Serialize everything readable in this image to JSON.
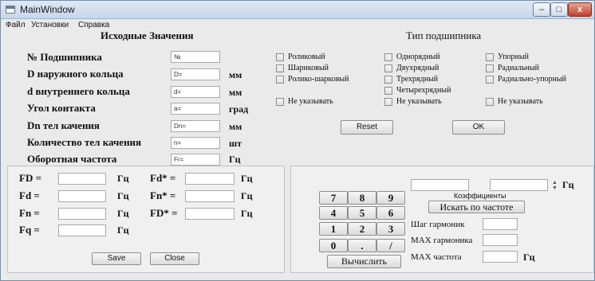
{
  "window": {
    "title": "MainWindow"
  },
  "titlebar_buttons": {
    "minimize": "–",
    "maximize": "□",
    "close": "x"
  },
  "menu": [
    "Файл",
    "Установки",
    "Справка"
  ],
  "initial_values": {
    "heading": "Исходные Значения",
    "rows": [
      {
        "label": "№ Подшипника",
        "placeholder": "№",
        "unit": ""
      },
      {
        "label": "D наружного кольца",
        "placeholder": "D=",
        "unit": "мм"
      },
      {
        "label": "d внутреннего кольца",
        "placeholder": "d=",
        "unit": "мм"
      },
      {
        "label": "Угол контакта",
        "placeholder": "a=",
        "unit": "град"
      },
      {
        "label": "Dn тел качения",
        "placeholder": "Dn=",
        "unit": "мм"
      },
      {
        "label": "Количество тел качения",
        "placeholder": "n=",
        "unit": "шт"
      },
      {
        "label": "Оборотная частота",
        "placeholder": "Fr=",
        "unit": "Гц"
      }
    ]
  },
  "bearing_type": {
    "heading": "Тип подшипника",
    "col1": [
      "Роликовый",
      "Шариковый",
      "Ролико-шарковый",
      "Не указывать"
    ],
    "col2": [
      "Однорядный",
      "Двухрядный",
      "Трехрядный",
      "Четырехрядный",
      "Не указывать"
    ],
    "col3": [
      "Упорный",
      "Радиальный",
      "Радиально-упорный",
      "Не указывать"
    ],
    "reset": "Reset",
    "ok": "OK"
  },
  "frequencies": {
    "left": [
      {
        "label": "FD =",
        "unit": "Гц"
      },
      {
        "label": "Fd =",
        "unit": "Гц"
      },
      {
        "label": "Fn =",
        "unit": "Гц"
      },
      {
        "label": "Fq =",
        "unit": "Гц"
      }
    ],
    "right": [
      {
        "label": "Fd* =",
        "unit": "Гц"
      },
      {
        "label": "Fn* =",
        "unit": "Гц"
      },
      {
        "label": "FD* =",
        "unit": "Гц"
      }
    ],
    "save": "Save",
    "close": "Close"
  },
  "keypad": {
    "keys": [
      "7",
      "8",
      "9",
      "4",
      "5",
      "6",
      "1",
      "2",
      "3",
      "0",
      ".",
      "/"
    ],
    "calculate": "Вычислить"
  },
  "harmonics": {
    "spin_unit": "Гц",
    "coefficients_label": "Коэффициенты",
    "search_button": "Искать по частоте",
    "step_label": "Шаг гармоник",
    "max_harmonic_label": "MAX гармоника",
    "max_freq_label": "MAX частота",
    "max_freq_unit": "Гц"
  }
}
